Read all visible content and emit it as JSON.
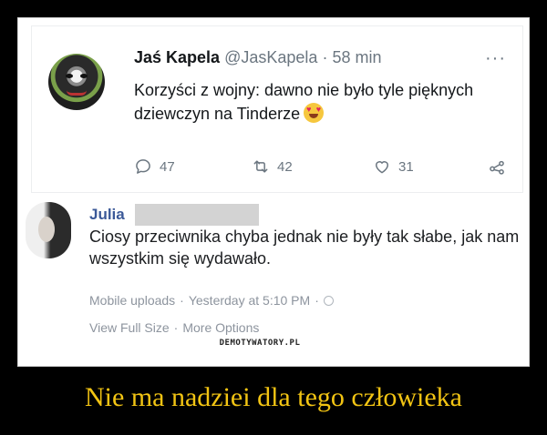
{
  "tweet": {
    "author_name": "Jaś Kapela",
    "handle": "@JasKapela",
    "separator": "·",
    "time": "58 min",
    "text": "Korzyści z wojny: dawno nie było tyle pięknych dziewczyn na Tinderze",
    "more_icon": "more-icon",
    "replies": "47",
    "retweets": "42",
    "likes": "31",
    "accent": "#6b7680"
  },
  "post": {
    "author_name": "Julia",
    "text": "Ciosy przeciwnika chyba jednak nie były tak słabe, jak nam wszystkim się wydawało.",
    "meta_source": "Mobile uploads",
    "meta_sep": "·",
    "meta_time": "Yesterday at 5:10 PM",
    "meta_sep2": "·",
    "link_view": "View Full Size",
    "link_sep": "·",
    "link_more": "More Options",
    "name_color": "#3b5998"
  },
  "watermark": "DEMOTYWATORY.PL",
  "caption": "Nie ma nadziei dla tego człowieka",
  "caption_color": "#f2c413"
}
